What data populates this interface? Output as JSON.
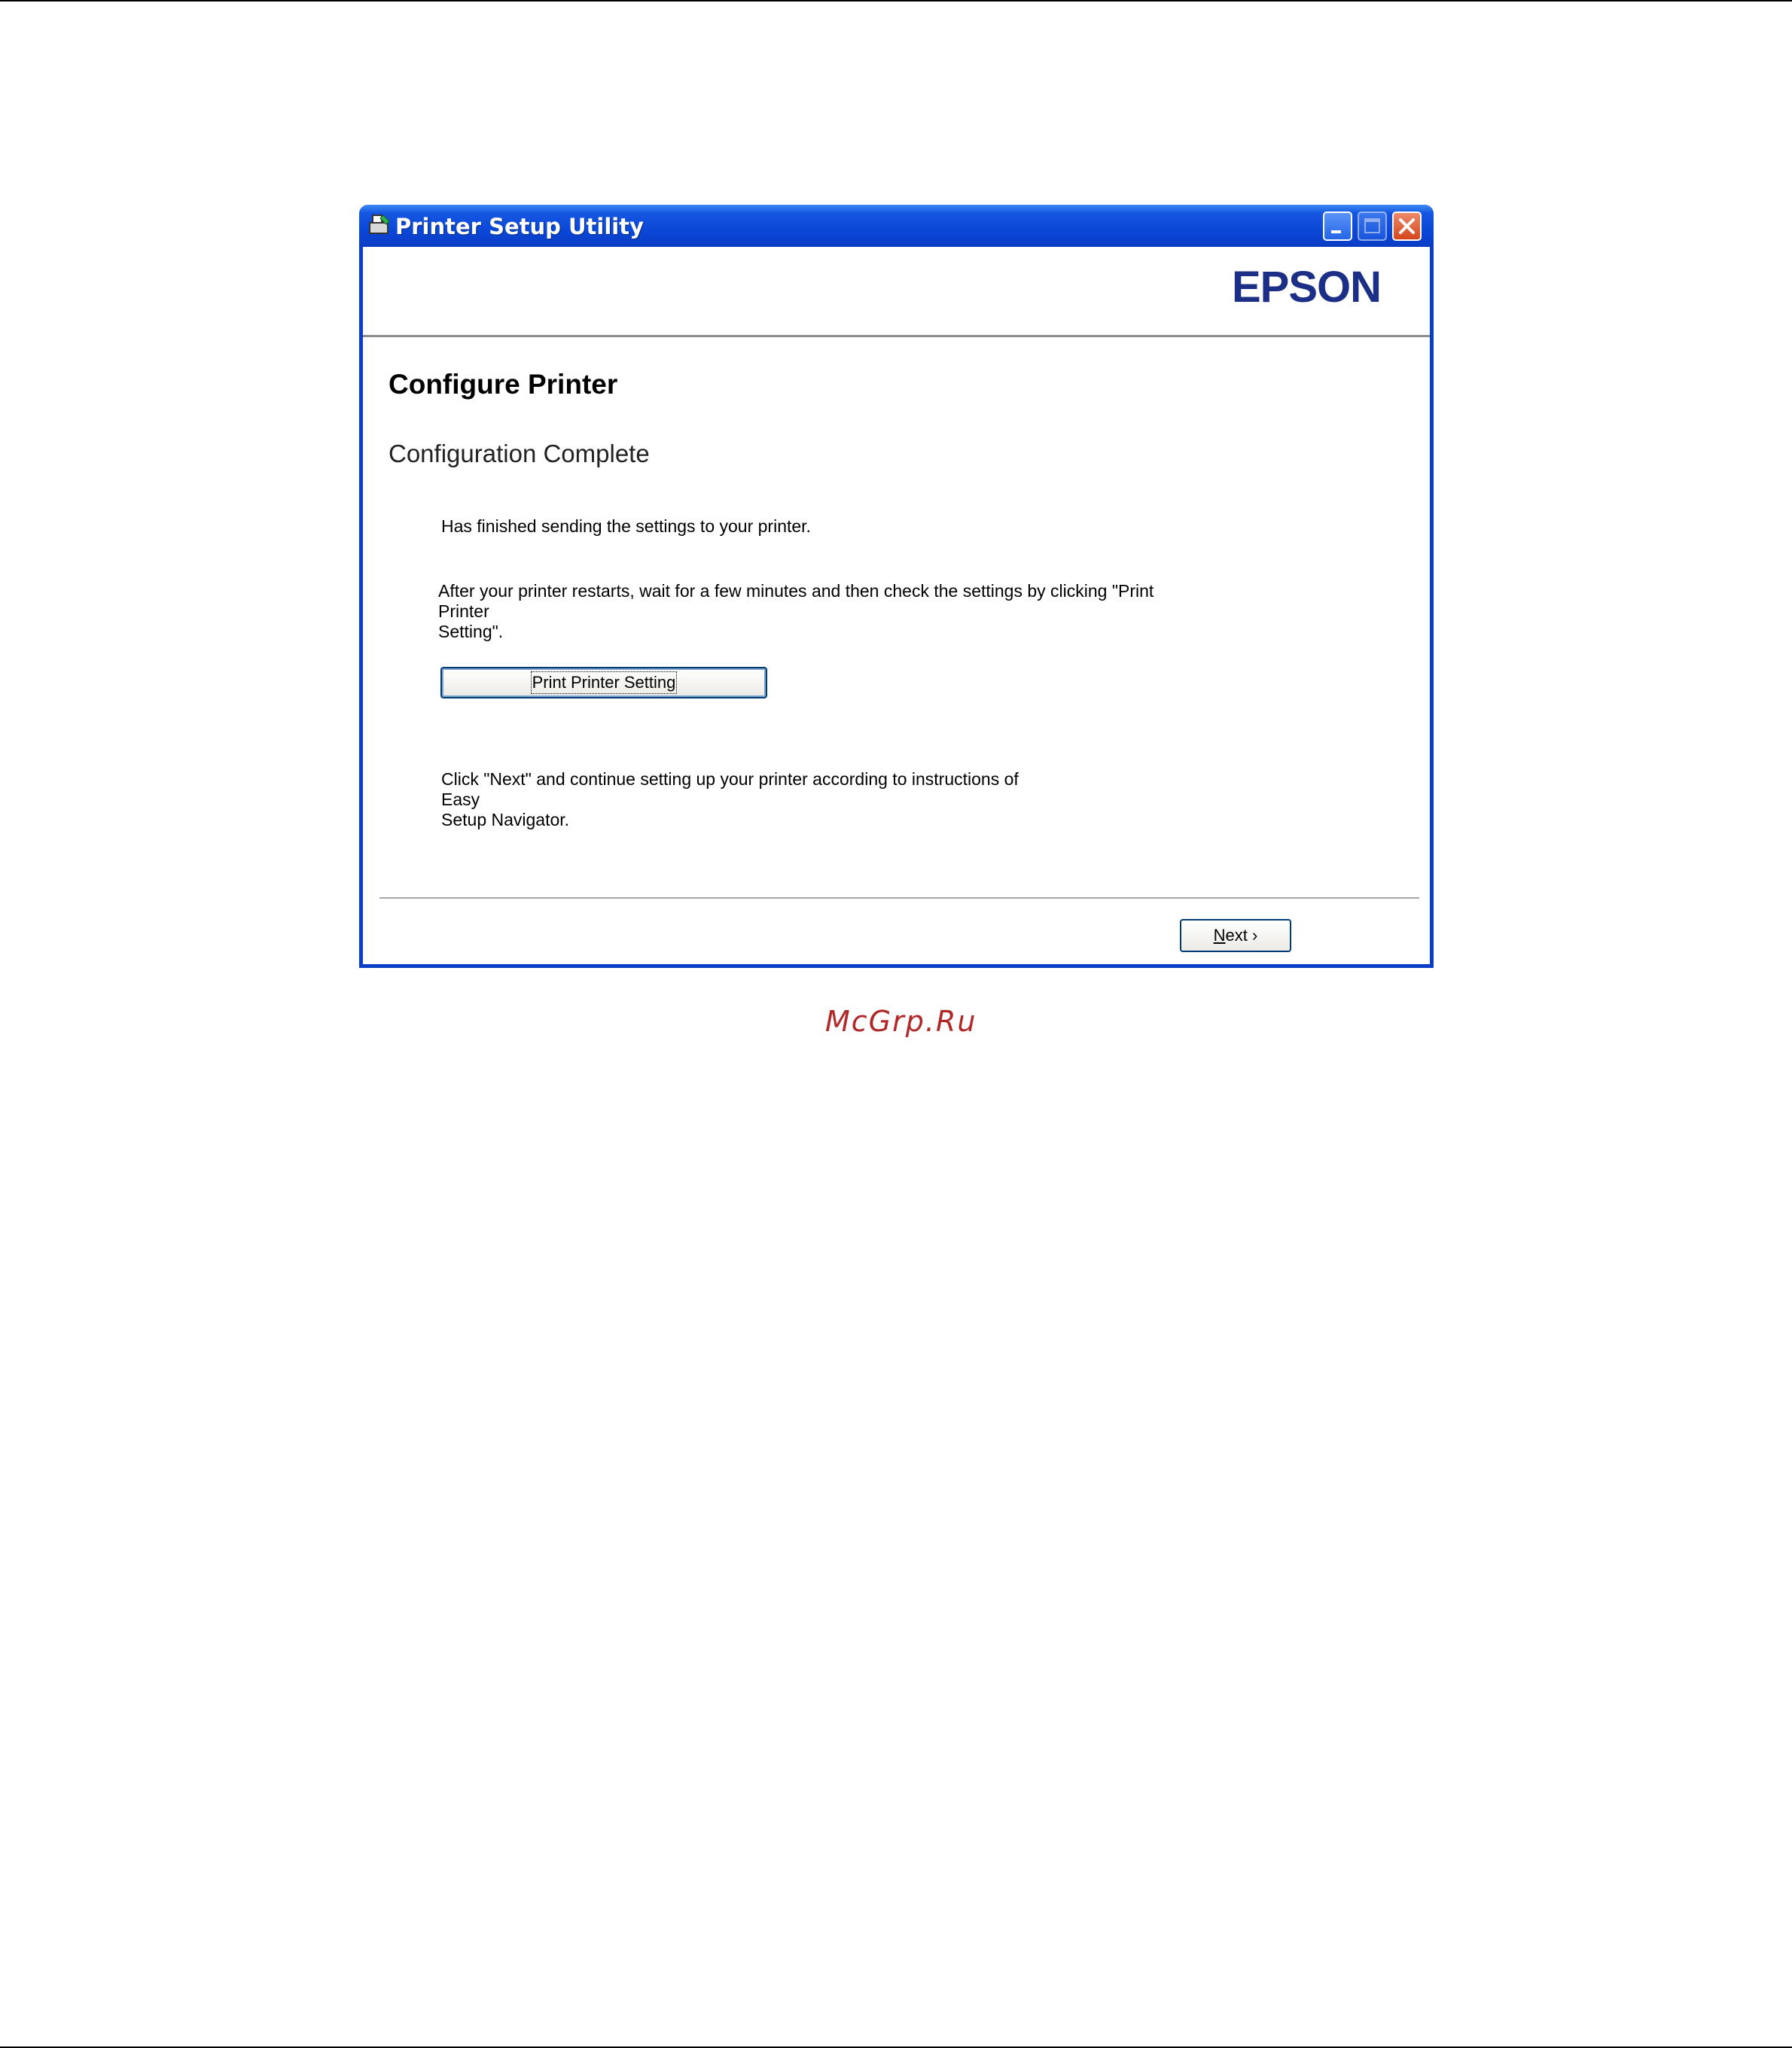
{
  "window": {
    "title": "Printer Setup Utility",
    "brand": "EPSON"
  },
  "content": {
    "heading": "Configure Printer",
    "subheading": "Configuration Complete",
    "message_sent": "Has finished sending the settings to your printer.",
    "message_restart_line1": "After your printer restarts, wait for a few minutes and then check the settings by clicking \"Print Printer",
    "message_restart_line2": "Setting\".",
    "print_button_label": "Print Printer Setting",
    "message_next_line1": "Click \"Next\" and continue setting up your printer according to instructions of Easy",
    "message_next_line2": "Setup Navigator."
  },
  "footer": {
    "next_label_accel": "N",
    "next_label_rest": "ext",
    "next_arrow": "›"
  },
  "watermark": "McGrp.Ru",
  "colors": {
    "titlebar": "#0a46d6",
    "brand": "#1b2f86",
    "watermark": "#b02828"
  },
  "icons": [
    "app-icon",
    "minimize-icon",
    "maximize-icon",
    "close-icon"
  ]
}
